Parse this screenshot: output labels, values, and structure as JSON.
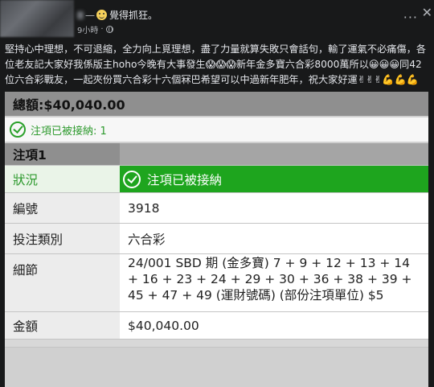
{
  "post": {
    "author_name": "覺得抓狂。",
    "time": "9小時",
    "separator": "·",
    "more_label": "···",
    "close_label": "✕",
    "body_lines": [
      "堅持心中理想，不可退縮，全力向上覓理想，盡了力量就算失敗只會話句，輸了運氣不必痛傷，各",
      "位老友記大家好我係版主hoho今晚有大事發生😱😱😱新年金多寶六合彩8000萬所以😀😀😀同42",
      "位六合彩戰友，一起夾份買六合彩十六個冧巴希望可以中過新年肥年，祝大家好運✌✌✌💪💪💪"
    ]
  },
  "ticket": {
    "total_label": "總額:$40,040.00",
    "accepted_label": "注項已被接納: 1",
    "item_header": "注項1",
    "rows": {
      "status_label": "狀況",
      "status_value": "注項已被接納",
      "number_label": "編號",
      "number_value": "3918",
      "type_label": "投注類別",
      "type_value": "六合彩",
      "detail_label": "細節",
      "detail_value": "24/001 SBD 期 (金多寶) 7 + 9 + 12 + 13 + 14 + 16 + 23 + 24 + 29 + 30 + 36 + 38 + 39 + 45 + 47 + 49 (運財號碼) (部份注項單位) $5",
      "amount_label": "金額",
      "amount_value": "$40,040.00"
    }
  },
  "colors": {
    "background": "#18191a",
    "accent_green": "#1ea51e",
    "header_gray": "#8f8f8f"
  }
}
